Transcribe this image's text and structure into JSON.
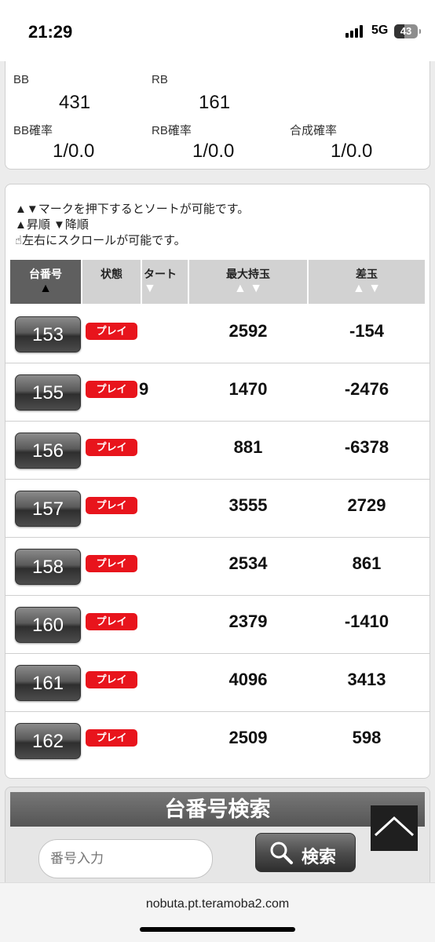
{
  "status_bar": {
    "time": "21:29",
    "network": "5G",
    "battery": "43"
  },
  "stats": {
    "bb_label": "BB",
    "bb_value": "431",
    "rb_label": "RB",
    "rb_value": "161",
    "bb_prob_label": "BB確率",
    "bb_prob_value": "1/0.0",
    "rb_prob_label": "RB確率",
    "rb_prob_value": "1/0.0",
    "combined_prob_label": "合成確率",
    "combined_prob_value": "1/0.0"
  },
  "notice": {
    "line1": "▲▼マークを押下するとソートが可能です。",
    "line2": "▲昇順 ▼降順",
    "line3": "左右にスクロールが可能です。"
  },
  "table": {
    "headers": {
      "number": "台番号",
      "number_sort": "▲",
      "status": "状態",
      "start": "タート",
      "start_sort": "▼",
      "max_balls": "最大持玉",
      "max_sort": "▲ ▼",
      "diff": "差玉",
      "diff_sort": "▲ ▼"
    },
    "rows": [
      {
        "number": "153",
        "status": "プレイ",
        "start_cut": "",
        "max_balls": "2592",
        "diff": "-154"
      },
      {
        "number": "155",
        "status": "プレイ",
        "start_cut": "9",
        "max_balls": "1470",
        "diff": "-2476"
      },
      {
        "number": "156",
        "status": "プレイ",
        "start_cut": "",
        "max_balls": "881",
        "diff": "-6378"
      },
      {
        "number": "157",
        "status": "プレイ",
        "start_cut": "",
        "max_balls": "3555",
        "diff": "2729"
      },
      {
        "number": "158",
        "status": "プレイ",
        "start_cut": "",
        "max_balls": "2534",
        "diff": "861"
      },
      {
        "number": "160",
        "status": "プレイ",
        "start_cut": "",
        "max_balls": "2379",
        "diff": "-1410"
      },
      {
        "number": "161",
        "status": "プレイ",
        "start_cut": "",
        "max_balls": "4096",
        "diff": "3413"
      },
      {
        "number": "162",
        "status": "プレイ",
        "start_cut": "",
        "max_balls": "2509",
        "diff": "598"
      }
    ]
  },
  "search": {
    "title": "台番号検索",
    "placeholder": "番号入力",
    "button_label": "検索"
  },
  "browser": {
    "url": "nobuta.pt.teramoba2.com"
  },
  "colors": {
    "play_badge": "#e8141c",
    "header_active": "#5f5f5f"
  }
}
